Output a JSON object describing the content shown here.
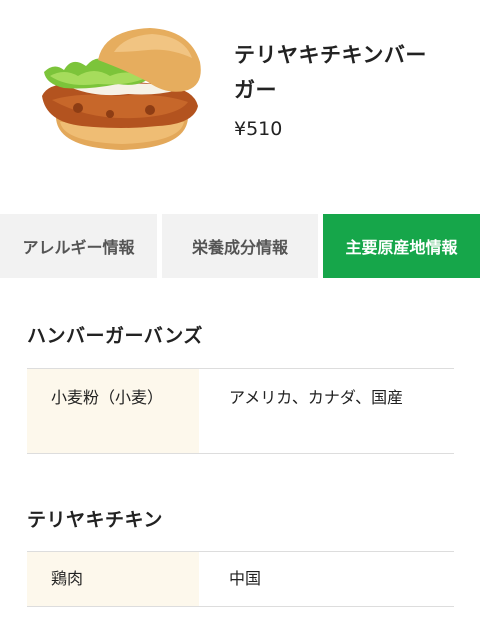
{
  "product": {
    "name": "テリヤキチキンバーガー",
    "price": "¥510"
  },
  "tabs": [
    {
      "label": "アレルギー情報",
      "active": false
    },
    {
      "label": "栄養成分情報",
      "active": false
    },
    {
      "label": "主要原産地情報",
      "active": true
    }
  ],
  "sections": [
    {
      "title": "ハンバーガーバンズ",
      "rows": [
        {
          "ingredient": "小麦粉（小麦）",
          "origin": "アメリカ、カナダ、国産"
        }
      ]
    },
    {
      "title": "テリヤキチキン",
      "rows": [
        {
          "ingredient": "鶏肉",
          "origin": "中国"
        }
      ]
    }
  ],
  "colors": {
    "active_tab": "#16a64a",
    "inactive_tab": "#f2f2f2",
    "ingredient_cell": "#fdf8ec"
  }
}
